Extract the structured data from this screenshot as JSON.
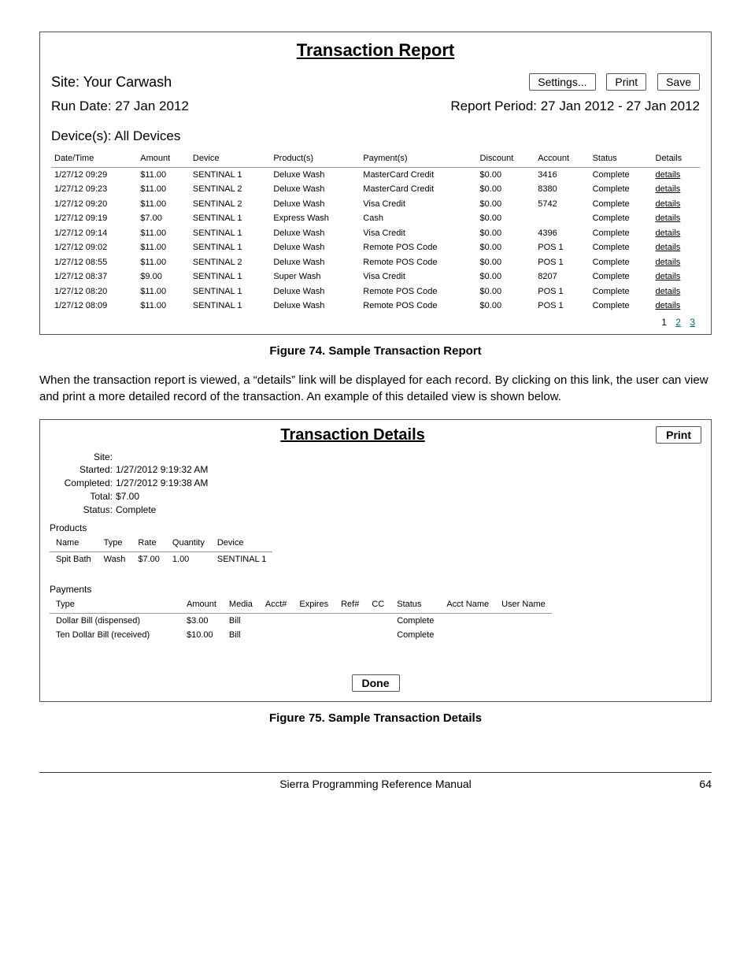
{
  "report": {
    "title": "Transaction Report",
    "site_label": "Site: Your Carwash",
    "run_date": "Run Date: 27 Jan 2012",
    "report_period": "Report Period: 27 Jan 2012 - 27 Jan 2012",
    "devices": "Device(s): All Devices",
    "buttons": {
      "settings": "Settings...",
      "print": "Print",
      "save": "Save"
    },
    "headers": [
      "Date/Time",
      "Amount",
      "Device",
      "Product(s)",
      "Payment(s)",
      "Discount",
      "Account",
      "Status",
      "Details"
    ],
    "rows": [
      {
        "dt": "1/27/12 09:29",
        "amt": "$11.00",
        "dev": "SENTINAL 1",
        "prod": "Deluxe Wash",
        "pay": "MasterCard Credit",
        "disc": "$0.00",
        "acct": "3416",
        "status": "Complete",
        "link": "details"
      },
      {
        "dt": "1/27/12 09:23",
        "amt": "$11.00",
        "dev": "SENTINAL 2",
        "prod": "Deluxe Wash",
        "pay": "MasterCard Credit",
        "disc": "$0.00",
        "acct": "8380",
        "status": "Complete",
        "link": "details"
      },
      {
        "dt": "1/27/12 09:20",
        "amt": "$11.00",
        "dev": "SENTINAL 2",
        "prod": "Deluxe Wash",
        "pay": "Visa Credit",
        "disc": "$0.00",
        "acct": "5742",
        "status": "Complete",
        "link": "details"
      },
      {
        "dt": "1/27/12 09:19",
        "amt": "$7.00",
        "dev": "SENTINAL 1",
        "prod": "Express Wash",
        "pay": "Cash",
        "disc": "$0.00",
        "acct": "",
        "status": "Complete",
        "link": "details"
      },
      {
        "dt": "1/27/12 09:14",
        "amt": "$11.00",
        "dev": "SENTINAL 1",
        "prod": "Deluxe Wash",
        "pay": "Visa Credit",
        "disc": "$0.00",
        "acct": "4396",
        "status": "Complete",
        "link": "details"
      },
      {
        "dt": "1/27/12 09:02",
        "amt": "$11.00",
        "dev": "SENTINAL 1",
        "prod": "Deluxe Wash",
        "pay": "Remote POS Code",
        "disc": "$0.00",
        "acct": "POS 1",
        "status": "Complete",
        "link": "details"
      },
      {
        "dt": "1/27/12 08:55",
        "amt": "$11.00",
        "dev": "SENTINAL 2",
        "prod": "Deluxe Wash",
        "pay": "Remote POS Code",
        "disc": "$0.00",
        "acct": "POS 1",
        "status": "Complete",
        "link": "details"
      },
      {
        "dt": "1/27/12 08:37",
        "amt": "$9.00",
        "dev": "SENTINAL 1",
        "prod": "Super Wash",
        "pay": "Visa Credit",
        "disc": "$0.00",
        "acct": "8207",
        "status": "Complete",
        "link": "details"
      },
      {
        "dt": "1/27/12 08:20",
        "amt": "$11.00",
        "dev": "SENTINAL 1",
        "prod": "Deluxe Wash",
        "pay": "Remote POS Code",
        "disc": "$0.00",
        "acct": "POS 1",
        "status": "Complete",
        "link": "details"
      },
      {
        "dt": "1/27/12 08:09",
        "amt": "$11.00",
        "dev": "SENTINAL 1",
        "prod": "Deluxe Wash",
        "pay": "Remote POS Code",
        "disc": "$0.00",
        "acct": "POS 1",
        "status": "Complete",
        "link": "details"
      }
    ],
    "pager": {
      "current": "1",
      "p2": "2",
      "p3": "3"
    }
  },
  "fig1_caption": "Figure 74. Sample Transaction Report",
  "body_text": "When the transaction report is viewed, a “details” link will be displayed for each record. By clicking on this link, the user can view and print a more detailed record of the transaction. An example of this detailed view is shown below.",
  "details": {
    "title": "Transaction Details",
    "print": "Print",
    "meta": {
      "site_k": "Site:",
      "site_v": "",
      "started_k": "Started:",
      "started_v": "1/27/2012 9:19:32 AM",
      "completed_k": "Completed:",
      "completed_v": "1/27/2012 9:19:38 AM",
      "total_k": "Total:",
      "total_v": "$7.00",
      "status_k": "Status:",
      "status_v": "Complete"
    },
    "products_label": "Products",
    "prod_headers": [
      "Name",
      "Type",
      "Rate",
      "Quantity",
      "Device"
    ],
    "prod_rows": [
      {
        "name": "Spit Bath",
        "type": "Wash",
        "rate": "$7.00",
        "qty": "1.00",
        "dev": "SENTINAL 1"
      }
    ],
    "payments_label": "Payments",
    "pay_headers": [
      "Type",
      "Amount",
      "Media",
      "Acct#",
      "Expires",
      "Ref#",
      "CC",
      "Status",
      "Acct Name",
      "User Name"
    ],
    "pay_rows": [
      {
        "type": "Dollar Bill (dispensed)",
        "amt": "$3.00",
        "media": "Bill",
        "acct": "",
        "exp": "",
        "ref": "",
        "cc": "",
        "status": "Complete",
        "an": "",
        "un": ""
      },
      {
        "type": "Ten Dollar Bill (received)",
        "amt": "$10.00",
        "media": "Bill",
        "acct": "",
        "exp": "",
        "ref": "",
        "cc": "",
        "status": "Complete",
        "an": "",
        "un": ""
      }
    ],
    "done": "Done"
  },
  "fig2_caption": "Figure 75. Sample Transaction Details",
  "footer": {
    "title": "Sierra Programming Reference Manual",
    "page": "64"
  }
}
